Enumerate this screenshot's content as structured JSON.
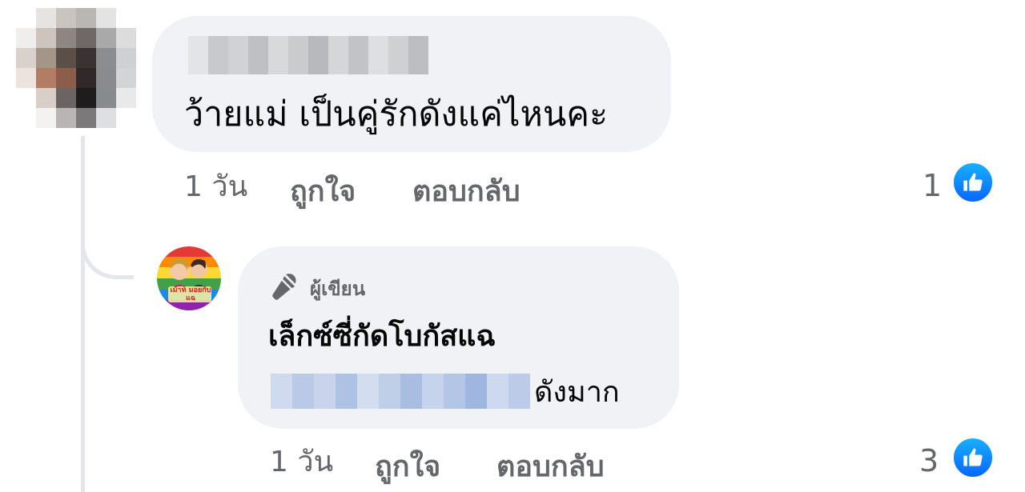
{
  "comments": [
    {
      "text": "ว้ายแม่ เป็นคู่รักดังแค่ไหนคะ",
      "time": "1 วัน",
      "like_label": "ถูกใจ",
      "reply_label": "ตอบกลับ",
      "reaction_count": "1",
      "reaction_icon": "like-icon"
    }
  ],
  "reply": {
    "badge_label": "ผู้เขียน",
    "badge_icon": "microphone-icon",
    "line1": "เล็กซ์ซี่กัดโบกัสแฉ",
    "line2_suffix": "ดังมาก",
    "time": "1 วัน",
    "like_label": "ถูกใจ",
    "reply_label": "ตอบกลับ",
    "reaction_count": "3",
    "reaction_icon": "like-icon",
    "avatar_text": "เม้าท์ มอยกับ แฉ"
  },
  "colors": {
    "bubble": "#f0f2f5",
    "meta_text": "#65676b",
    "like_blue": "#0866ff",
    "thread_line": "#e4e6eb"
  }
}
